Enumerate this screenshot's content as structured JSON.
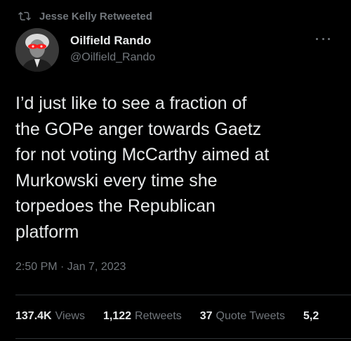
{
  "retweet_context": {
    "label": "Jesse Kelly Retweeted"
  },
  "author": {
    "display_name": "Oilfield Rando",
    "handle": "@Oilfield_Rando"
  },
  "tweet": {
    "text": "I’d just like to see a fraction of\nthe GOPe anger towards Gaetz\nfor not voting McCarthy aimed at\nMurkowski every time she\ntorpedoes the Republican\nplatform",
    "timestamp": "2:50 PM · Jan 7, 2023"
  },
  "stats": {
    "views_count": "137.4K",
    "views_label": "Views",
    "retweets_count": "1,122",
    "retweets_label": "Retweets",
    "quotes_count": "37",
    "quotes_label": "Quote Tweets",
    "likes_count": "5,2"
  },
  "colors": {
    "background": "#000000",
    "text_primary": "#e7e9ea",
    "text_secondary": "#71767b",
    "divider": "#2f3336",
    "avatar_eyes": "#ff1a1a"
  },
  "icons": {
    "retweet": "retweet-icon",
    "more": "more-icon"
  }
}
